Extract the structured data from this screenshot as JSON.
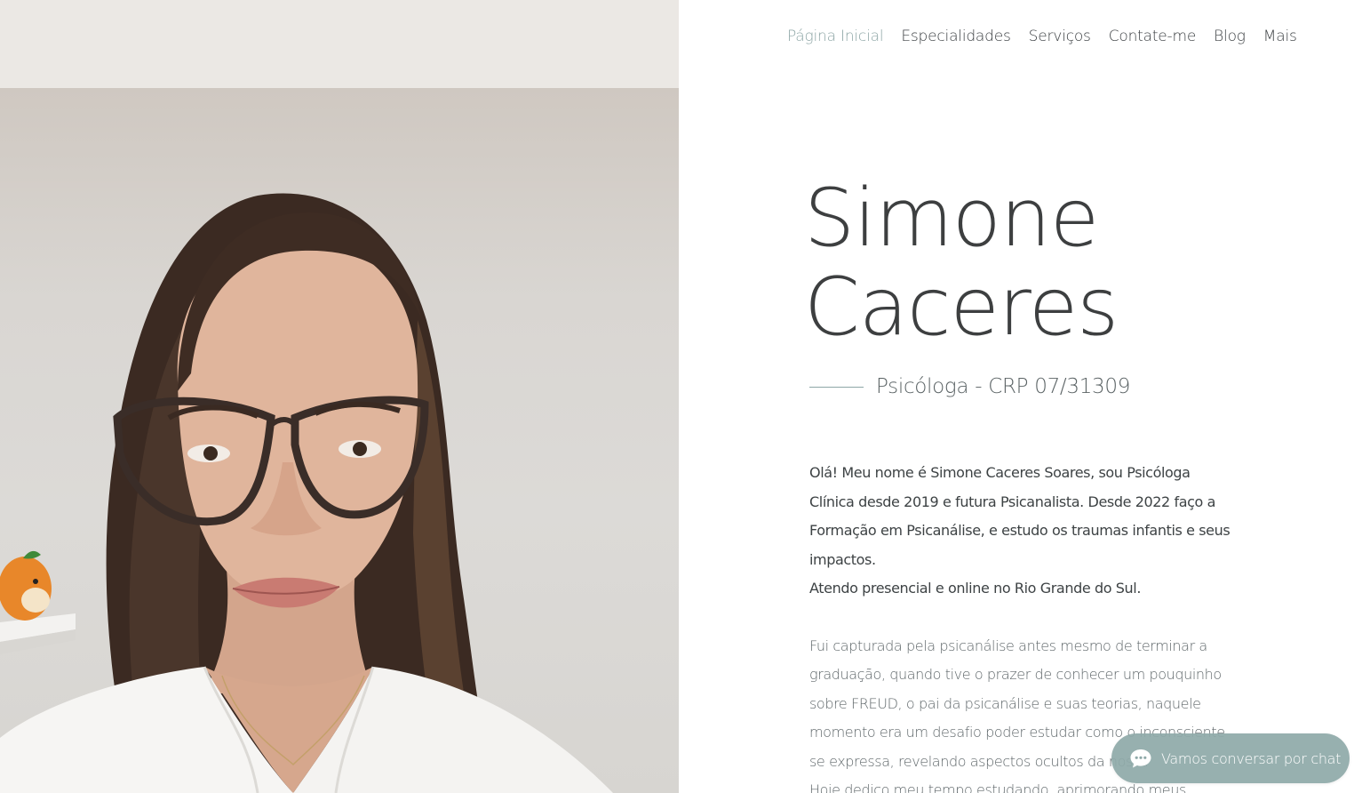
{
  "nav": {
    "items": [
      {
        "label": "Página Inicial",
        "active": true
      },
      {
        "label": "Especialidades",
        "active": false
      },
      {
        "label": "Serviços",
        "active": false
      },
      {
        "label": "Contate-me",
        "active": false
      },
      {
        "label": "Blog",
        "active": false
      },
      {
        "label": "Mais",
        "active": false
      }
    ]
  },
  "hero": {
    "first_name": "Simone",
    "last_name": "Caceres",
    "subtitle": "Psicóloga - CRP 07/31309"
  },
  "bio": {
    "paragraph1": [
      "Olá!  Meu nome é Simone Caceres Soares, sou Psicóloga Clínica desde 2019 e futura Psicanalista. Desde 2022 faço a Formação em Psicanálise, e estudo os traumas infantis e seus impactos.",
      "Atendo presencial e online no Rio Grande do Sul."
    ],
    "paragraph2": [
      "Fui capturada pela psicanálise antes mesmo de terminar a graduação, quando tive o prazer de conhecer um pouquinho sobre FREUD, o pai da psicanálise e suas teorias, naquele momento era um desafio poder estudar como o inconsciente se expressa, revelando aspectos ocultos da nossa",
      " Hoje dedico meu tempo estudando, aprimorando meus"
    ]
  },
  "chat": {
    "label": "Vamos conversar por chat",
    "icon": "chat-bubble-icon"
  },
  "colors": {
    "accent": "#8ea6a6",
    "text_dark": "#3d3f40",
    "text_body": "#5f676a",
    "chat_bg": "#8faaa9"
  }
}
